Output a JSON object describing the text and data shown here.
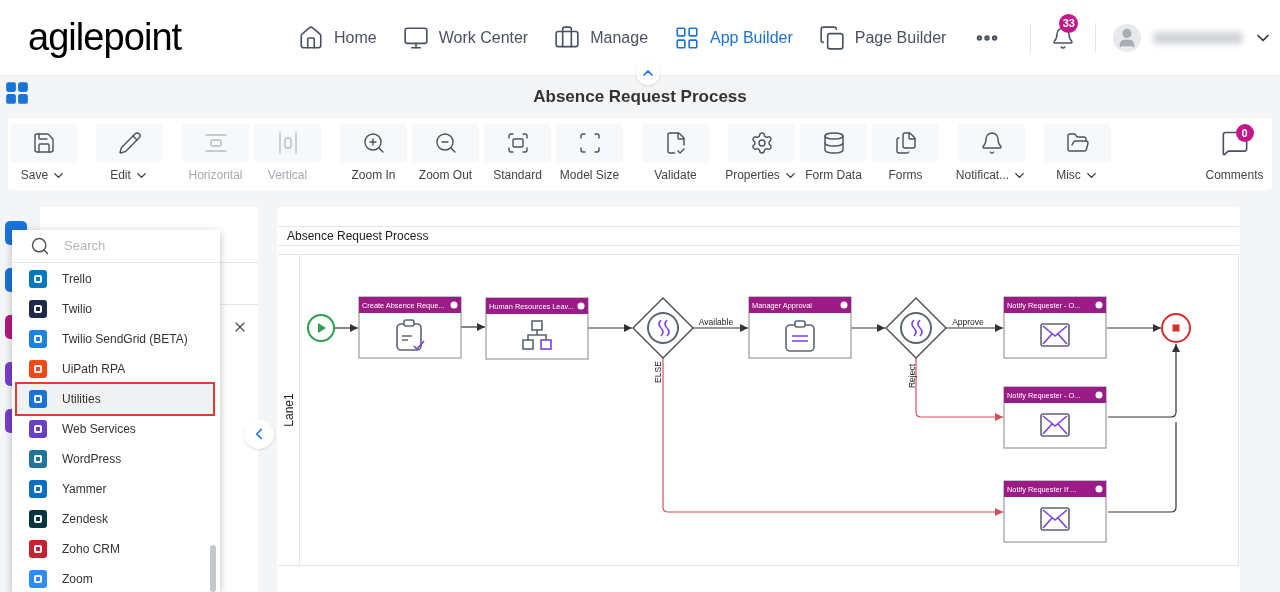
{
  "logo": {
    "text": "agilepoint"
  },
  "nav": {
    "items": [
      {
        "label": "Home",
        "selected": false
      },
      {
        "label": "Work Center",
        "selected": false
      },
      {
        "label": "Manage",
        "selected": false
      },
      {
        "label": "App Builder",
        "selected": true
      },
      {
        "label": "Page Builder",
        "selected": false
      }
    ],
    "notifications": {
      "count": "33"
    }
  },
  "title": "Absence Request Process",
  "toolbar": {
    "groups": [
      [
        {
          "label": "Save",
          "dropdown": true,
          "disabled": false
        }
      ],
      [
        {
          "label": "Edit",
          "dropdown": true,
          "disabled": false
        }
      ],
      [
        {
          "label": "Horizontal",
          "dropdown": false,
          "disabled": true
        },
        {
          "label": "Vertical",
          "dropdown": false,
          "disabled": true
        }
      ],
      [
        {
          "label": "Zoom In",
          "dropdown": false,
          "disabled": false
        },
        {
          "label": "Zoom Out",
          "dropdown": false,
          "disabled": false
        },
        {
          "label": "Standard",
          "dropdown": false,
          "disabled": false
        },
        {
          "label": "Model Size",
          "dropdown": false,
          "disabled": false
        }
      ],
      [
        {
          "label": "Validate",
          "dropdown": false,
          "disabled": false
        }
      ],
      [
        {
          "label": "Properties",
          "dropdown": true,
          "disabled": false
        },
        {
          "label": "Form Data",
          "dropdown": false,
          "disabled": false
        },
        {
          "label": "Forms",
          "dropdown": false,
          "disabled": false
        }
      ],
      [
        {
          "label": "Notificat...",
          "dropdown": true,
          "disabled": false
        }
      ],
      [
        {
          "label": "Misc",
          "dropdown": true,
          "disabled": false
        }
      ]
    ],
    "comments": {
      "label": "Comments",
      "count": "0"
    }
  },
  "library_menu": {
    "search": {
      "placeholder": "Search"
    },
    "items": [
      {
        "label": "Trello",
        "color": "#0079bf",
        "selected": false
      },
      {
        "label": "Twilio",
        "color": "#1e2a4a",
        "selected": false
      },
      {
        "label": "Twilio SendGrid (BETA)",
        "color": "#1a82e2",
        "selected": false
      },
      {
        "label": "UiPath RPA",
        "color": "#fa4616",
        "selected": false
      },
      {
        "label": "Utilities",
        "color": "#1a73d9",
        "selected": true
      },
      {
        "label": "Web Services",
        "color": "#6b3fc4",
        "selected": false
      },
      {
        "label": "WordPress",
        "color": "#21759b",
        "selected": false
      },
      {
        "label": "Yammer",
        "color": "#106ebe",
        "selected": false
      },
      {
        "label": "Zendesk",
        "color": "#03363d",
        "selected": false
      },
      {
        "label": "Zoho CRM",
        "color": "#c8202f",
        "selected": false
      },
      {
        "label": "Zoom",
        "color": "#2d8cff",
        "selected": false
      }
    ]
  },
  "process": {
    "title": "Absence Request Process",
    "lane": "Lane1",
    "nodes": [
      {
        "kind": "start"
      },
      {
        "kind": "form",
        "label": "Create Absence Reque..."
      },
      {
        "kind": "org",
        "label": "Human Resources Leav..."
      },
      {
        "kind": "gateway"
      },
      {
        "kind": "approval",
        "label": "Manager Approval"
      },
      {
        "kind": "gateway"
      },
      {
        "kind": "email",
        "label": "Notify Requester - O..."
      },
      {
        "kind": "end"
      },
      {
        "kind": "email",
        "label": "Notify Requester - O..."
      },
      {
        "kind": "email",
        "label": "Notify Requester If ..."
      }
    ],
    "edges": [
      {
        "kind": "normal"
      },
      {
        "kind": "normal"
      },
      {
        "kind": "normal"
      },
      {
        "kind": "normal",
        "label": "Available"
      },
      {
        "kind": "normal"
      },
      {
        "kind": "normal",
        "label": "Approve"
      },
      {
        "kind": "normal"
      },
      {
        "kind": "alternate",
        "label": "Reject"
      },
      {
        "kind": "alternate",
        "label": "ELSE"
      },
      {
        "kind": "normal"
      },
      {
        "kind": "normal"
      }
    ]
  }
}
